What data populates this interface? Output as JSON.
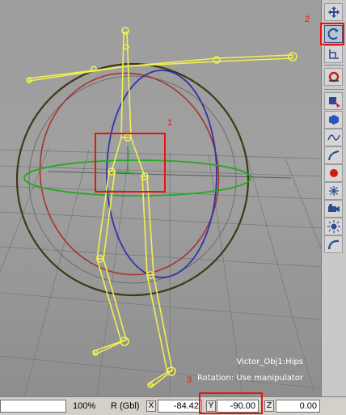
{
  "viewport": {
    "object_name": "Victor_Obj1:Hips",
    "mode_text": "Rotation: Use manipulator"
  },
  "toolbar": {
    "buttons": [
      {
        "icon": "translate-icon"
      },
      {
        "icon": "rotate-icon",
        "active": true
      },
      {
        "icon": "scale-icon"
      },
      {
        "icon": "magnet-icon"
      },
      {
        "icon": "select-object-icon"
      },
      {
        "icon": "cube-icon"
      },
      {
        "icon": "curve-icon"
      },
      {
        "icon": "bone-icon"
      },
      {
        "icon": "marker-icon"
      },
      {
        "icon": "null-icon"
      },
      {
        "icon": "camera-icon"
      },
      {
        "icon": "light-icon"
      },
      {
        "icon": "path-icon"
      }
    ]
  },
  "statusbar": {
    "zoom": "100%",
    "rotation_label": "R (Gbl)",
    "x_label": "X",
    "x_value": "-84.42",
    "y_label": "Y",
    "y_value": "-90.00",
    "z_label": "Z",
    "z_value": "0.00"
  },
  "callouts": {
    "one": "1",
    "two": "2",
    "three": "3"
  },
  "colors": {
    "callout_red": "#ee1111",
    "bone_yellow": "#f0f050",
    "ring_green": "#22aa22",
    "ring_blue": "#3333aa",
    "ring_red": "#aa3333"
  }
}
